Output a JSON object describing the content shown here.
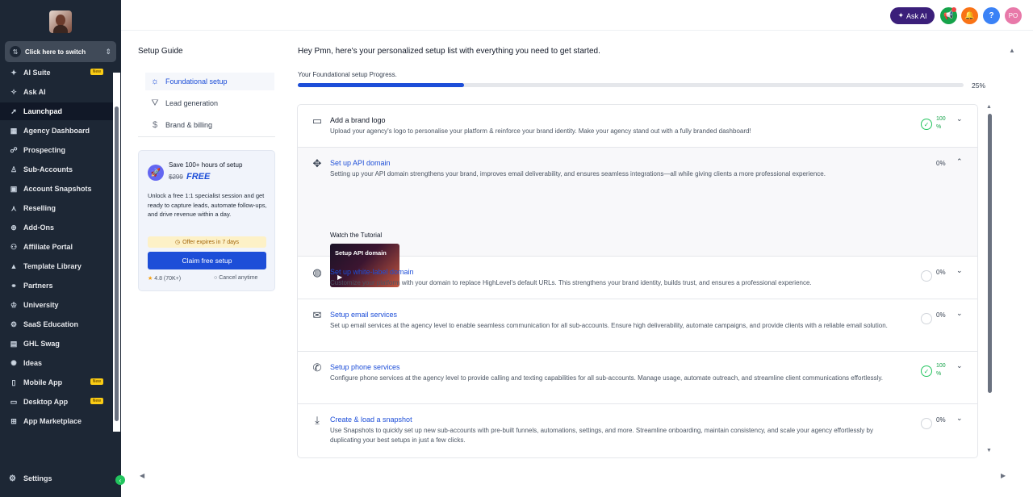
{
  "sidebar": {
    "switcher_label": "Click here to switch",
    "items": [
      {
        "label": "AI Suite",
        "icon": "sparkles-icon",
        "glyph": "✦",
        "badge": "New"
      },
      {
        "label": "Ask AI",
        "icon": "sparkle-icon",
        "glyph": "✧",
        "badge": ""
      },
      {
        "label": "Launchpad",
        "icon": "rocket-icon",
        "glyph": "➚",
        "badge": "",
        "active": true
      },
      {
        "label": "Agency Dashboard",
        "icon": "dashboard-icon",
        "glyph": "▦",
        "badge": ""
      },
      {
        "label": "Prospecting",
        "icon": "prospecting-icon",
        "glyph": "☍",
        "badge": ""
      },
      {
        "label": "Sub-Accounts",
        "icon": "user-icon",
        "glyph": "♙",
        "badge": ""
      },
      {
        "label": "Account Snapshots",
        "icon": "snapshot-icon",
        "glyph": "▣",
        "badge": ""
      },
      {
        "label": "Reselling",
        "icon": "reselling-icon",
        "glyph": "⋏",
        "badge": ""
      },
      {
        "label": "Add-Ons",
        "icon": "addons-icon",
        "glyph": "⊕",
        "badge": ""
      },
      {
        "label": "Affiliate Portal",
        "icon": "affiliate-icon",
        "glyph": "⚇",
        "badge": ""
      },
      {
        "label": "Template Library",
        "icon": "template-icon",
        "glyph": "▲",
        "badge": ""
      },
      {
        "label": "Partners",
        "icon": "handshake-icon",
        "glyph": "⚭",
        "badge": ""
      },
      {
        "label": "University",
        "icon": "graduation-icon",
        "glyph": "♔",
        "badge": ""
      },
      {
        "label": "SaaS Education",
        "icon": "education-icon",
        "glyph": "⚙",
        "badge": ""
      },
      {
        "label": "GHL Swag",
        "icon": "gift-icon",
        "glyph": "▤",
        "badge": ""
      },
      {
        "label": "Ideas",
        "icon": "bulb-icon",
        "glyph": "✺",
        "badge": ""
      },
      {
        "label": "Mobile App",
        "icon": "mobile-icon",
        "glyph": "▯",
        "badge": "New"
      },
      {
        "label": "Desktop App",
        "icon": "desktop-icon",
        "glyph": "▭",
        "badge": "New"
      },
      {
        "label": "App Marketplace",
        "icon": "grid-icon",
        "glyph": "⊞",
        "badge": ""
      }
    ],
    "settings_label": "Settings"
  },
  "topbar": {
    "ask_ai_label": "Ask AI",
    "help_glyph": "?",
    "profile_initials": "PO"
  },
  "guide": {
    "title": "Setup Guide",
    "nav": [
      {
        "label": "Foundational setup",
        "icon": "sun-icon",
        "glyph": "☼",
        "active": true
      },
      {
        "label": "Lead generation",
        "icon": "funnel-icon",
        "glyph": "⛛",
        "active": false
      },
      {
        "label": "Brand & billing",
        "icon": "dollar-icon",
        "glyph": "$",
        "active": false
      }
    ],
    "promo": {
      "headline": "Save 100+ hours of setup",
      "old_price": "$299",
      "new_price": "FREE",
      "description": "Unlock a free 1:1 specialist session and get ready to capture leads, automate follow-ups, and drive revenue within a day.",
      "offer": "Offer expires in 7 days",
      "cta": "Claim free setup",
      "rating": "4.8 (70K+)",
      "cancel": "Cancel anytime"
    }
  },
  "main": {
    "greeting": "Hey Pmn, here's your personalized setup list with everything you need to get started.",
    "progress_label": "Your Foundational setup Progress.",
    "progress_fraction": 0.25,
    "progress_text": "25%",
    "tasks": [
      {
        "title": "Add a brand logo",
        "description": "Upload your agency's logo to personalise your platform & reinforce your brand identity. Make your agency stand out with a fully branded dashboard!",
        "status": "100 %",
        "done": true,
        "expanded": false,
        "icon": "image-icon",
        "glyph": "▭"
      },
      {
        "title": "Set up API domain",
        "description": "Setting up your API domain strengthens your brand, improves email deliverability, and ensures seamless integrations—all while giving clients a more professional experience.",
        "status": "0%",
        "done": false,
        "expanded": true,
        "icon": "api-icon",
        "glyph": "✥",
        "tutorial_label": "Watch the Tutorial",
        "tutorial_title": "Setup API domain"
      },
      {
        "title": "Set up white-label domain",
        "description": "Customize your platform with your domain to replace HighLevel's default URLs. This strengthens your brand identity, builds trust, and ensures a professional experience.",
        "status": "0%",
        "done": false,
        "expanded": false,
        "icon": "globe-icon",
        "glyph": "◍"
      },
      {
        "title": "Setup email services",
        "description": "Set up email services at the agency level to enable seamless communication for all sub-accounts. Ensure high deliverability, automate campaigns, and provide clients with a reliable email solution.",
        "status": "0%",
        "done": false,
        "expanded": false,
        "icon": "mail-icon",
        "glyph": "✉"
      },
      {
        "title": "Setup phone services",
        "description": "Configure phone services at the agency level to provide calling and texting capabilities for all sub-accounts. Manage usage, automate outreach, and streamline client communications effortlessly.",
        "status": "100 %",
        "done": true,
        "expanded": false,
        "icon": "phone-icon",
        "glyph": "✆"
      },
      {
        "title": "Create & load a snapshot",
        "description": "Use Snapshots to quickly set up new sub-accounts with pre-built funnels, automations, settings, and more. Streamline onboarding, maintain consistency, and scale your agency effortlessly by duplicating your best setups in just a few clicks.",
        "status": "0%",
        "done": false,
        "expanded": false,
        "icon": "download-icon",
        "glyph": "⤓"
      }
    ]
  }
}
